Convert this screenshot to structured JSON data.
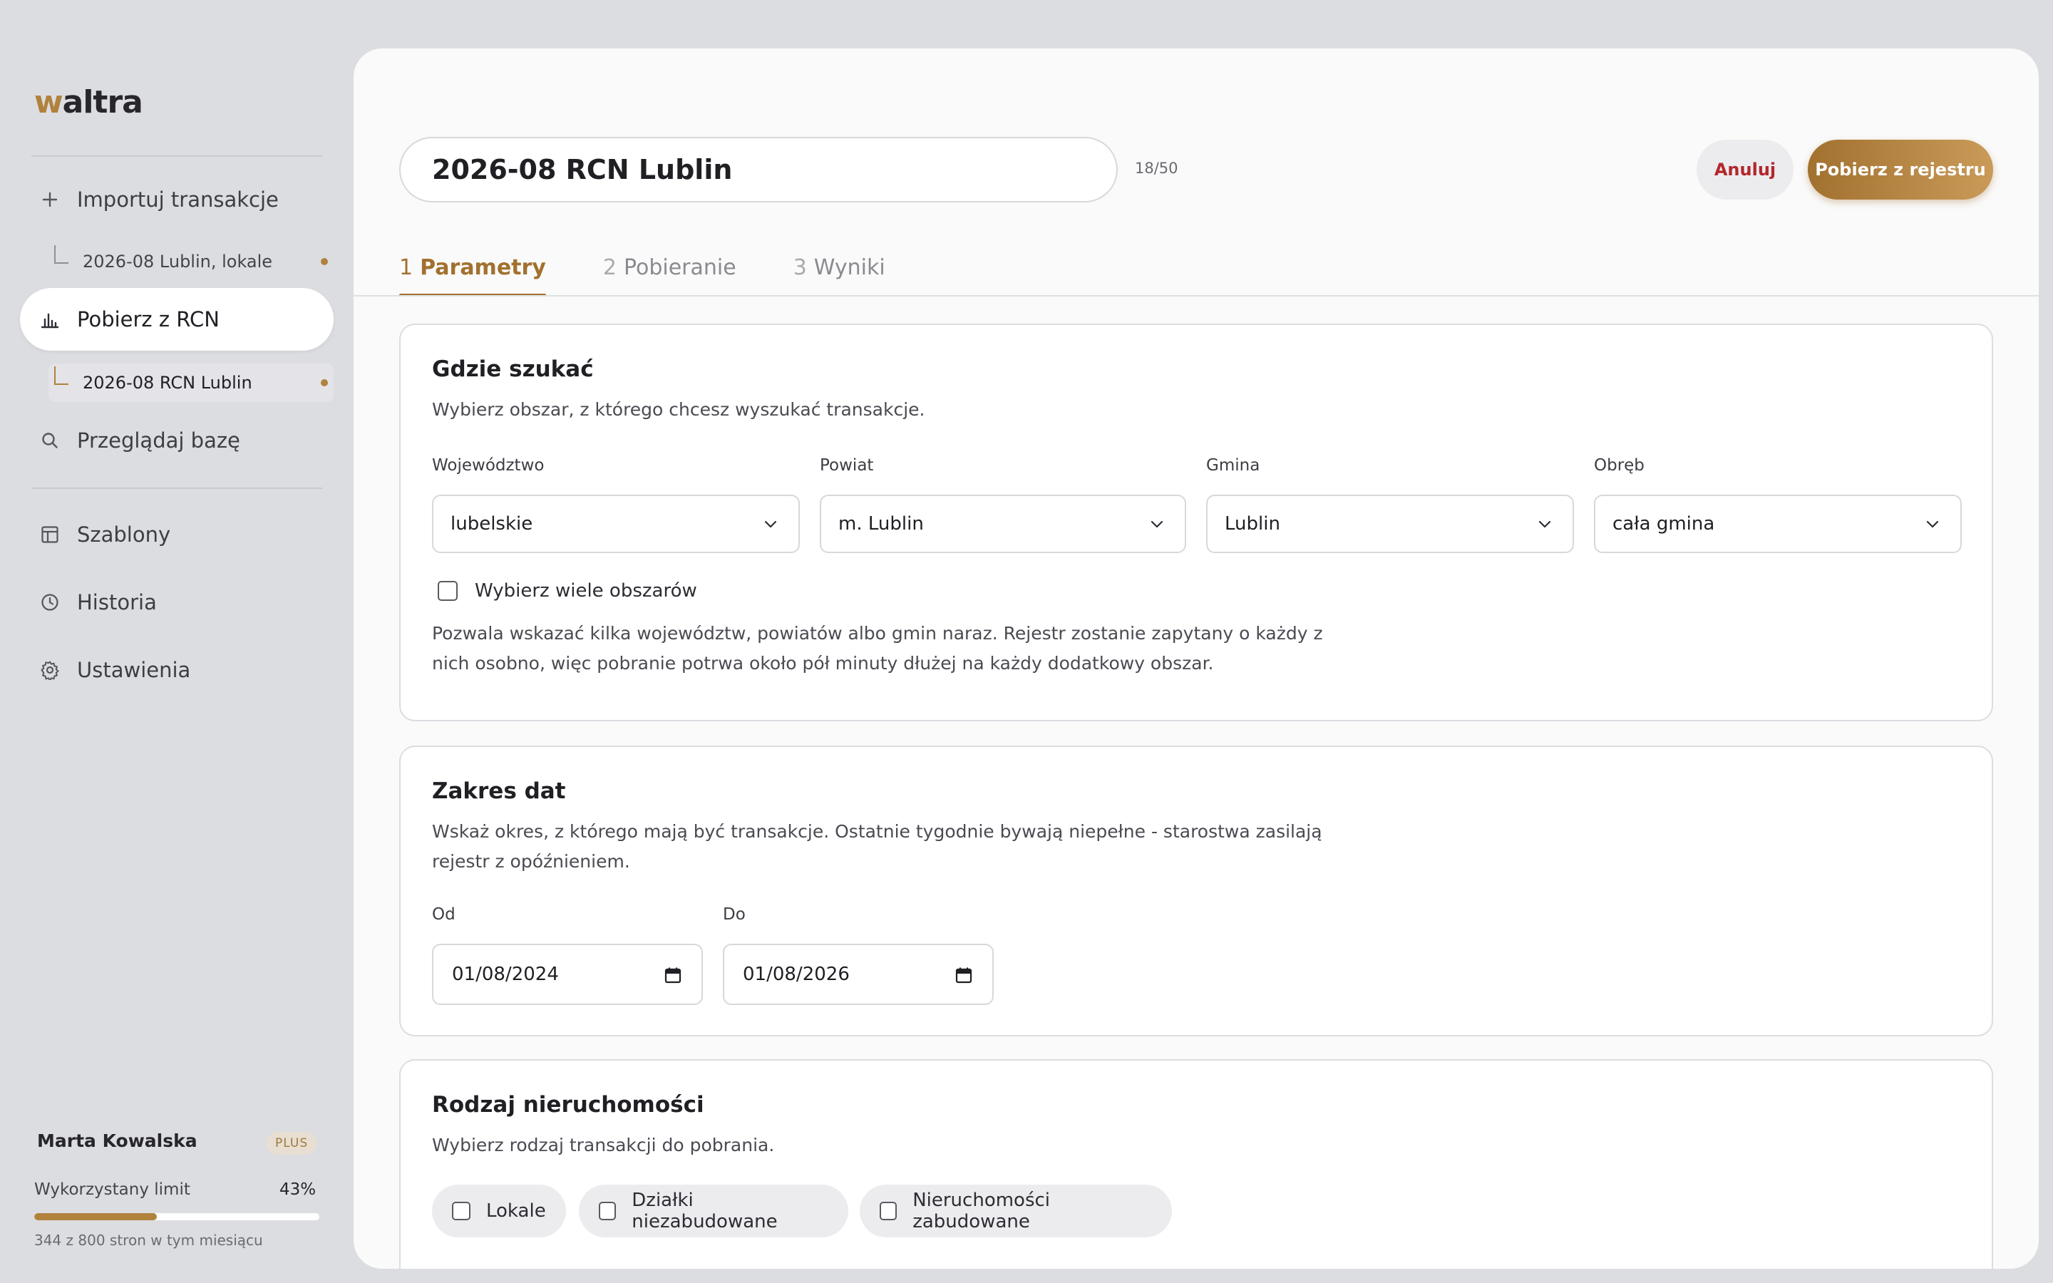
{
  "brand": {
    "logo_accent": "w",
    "logo_rest": "altra",
    "accent_color": "#b0823c"
  },
  "sidebar": {
    "import_label": "Importuj transakcje",
    "import_sub_label": "2026-08 Lublin, lokale",
    "rcn_label": "Pobierz z RCN",
    "rcn_sub_label": "2026-08 RCN Lublin",
    "browse_label": "Przeglądaj bazę",
    "templates_label": "Szablony",
    "history_label": "Historia",
    "settings_label": "Ustawienia"
  },
  "user": {
    "name": "Marta Kowalska",
    "plan": "PLUS",
    "limit_label": "Wykorzystany limit",
    "limit_percent_text": "43%",
    "limit_fraction": 0.43,
    "limit_note": "344 z 800 stron w tym miesiącu"
  },
  "header": {
    "title_value": "2026-08 RCN Lublin",
    "char_count": "18/50",
    "cancel_label": "Anuluj",
    "primary_label": "Pobierz z rejestru"
  },
  "tabs": [
    {
      "num": "1",
      "label": "Parametry"
    },
    {
      "num": "2",
      "label": "Pobieranie"
    },
    {
      "num": "3",
      "label": "Wyniki"
    }
  ],
  "location_card": {
    "title": "Gdzie szukać",
    "description": "Wybierz obszar, z którego chcesz wyszukać transakcje.",
    "fields": [
      {
        "label": "Województwo",
        "value": "lubelskie"
      },
      {
        "label": "Powiat",
        "value": "m. Lublin"
      },
      {
        "label": "Gmina",
        "value": "Lublin"
      },
      {
        "label": "Obręb",
        "value": "cała gmina"
      }
    ],
    "multi_label": "Wybierz wiele obszarów",
    "multi_hint": "Pozwala wskazać kilka województw, powiatów albo gmin naraz. Rejestr zostanie zapytany o każdy z nich osobno, więc pobranie potrwa około pół minuty dłużej na każdy dodatkowy obszar."
  },
  "dates_card": {
    "title": "Zakres dat",
    "description": "Wskaż okres, z którego mają być transakcje. Ostatnie tygodnie bywają niepełne - starostwa zasilają rejestr z opóźnieniem.",
    "from_label": "Od",
    "from_value": "01/08/2024",
    "to_label": "Do",
    "to_value": "01/08/2026"
  },
  "property_card": {
    "title": "Rodzaj nieruchomości",
    "description": "Wybierz rodzaj transakcji do pobrania.",
    "options": [
      "Lokale",
      "Działki niezabudowane",
      "Nieruchomości zabudowane"
    ]
  }
}
